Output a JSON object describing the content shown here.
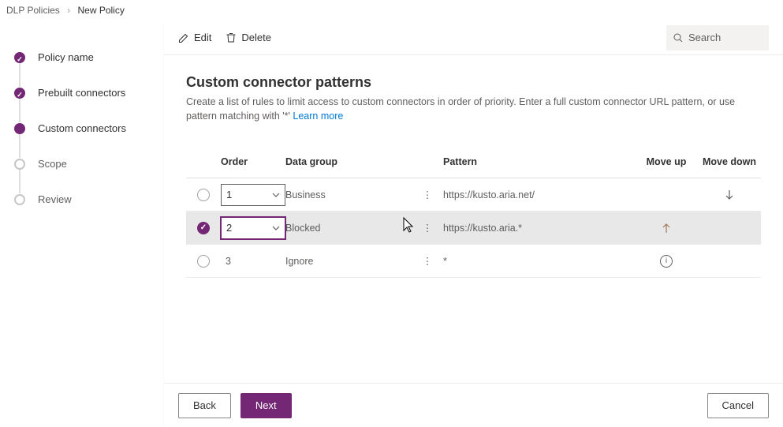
{
  "breadcrumb": {
    "parent": "DLP Policies",
    "current": "New Policy"
  },
  "sidebar": {
    "steps": [
      {
        "label": "Policy name"
      },
      {
        "label": "Prebuilt connectors"
      },
      {
        "label": "Custom connectors"
      },
      {
        "label": "Scope"
      },
      {
        "label": "Review"
      }
    ]
  },
  "toolbar": {
    "edit": "Edit",
    "delete": "Delete",
    "search_placeholder": "Search"
  },
  "page": {
    "title": "Custom connector patterns",
    "description": "Create a list of rules to limit access to custom connectors in order of priority. Enter a full custom connector URL pattern, or use pattern matching with '*' ",
    "learn_more": "Learn more"
  },
  "table": {
    "headers": {
      "order": "Order",
      "data_group": "Data group",
      "pattern": "Pattern",
      "move_up": "Move up",
      "move_down": "Move down"
    },
    "rows": [
      {
        "order": "1",
        "data_group": "Business",
        "pattern": "https://kusto.aria.net/"
      },
      {
        "order": "2",
        "data_group": "Blocked",
        "pattern": "https://kusto.aria.*"
      },
      {
        "order": "3",
        "data_group": "Ignore",
        "pattern": "*"
      }
    ]
  },
  "footer": {
    "back": "Back",
    "next": "Next",
    "cancel": "Cancel"
  }
}
